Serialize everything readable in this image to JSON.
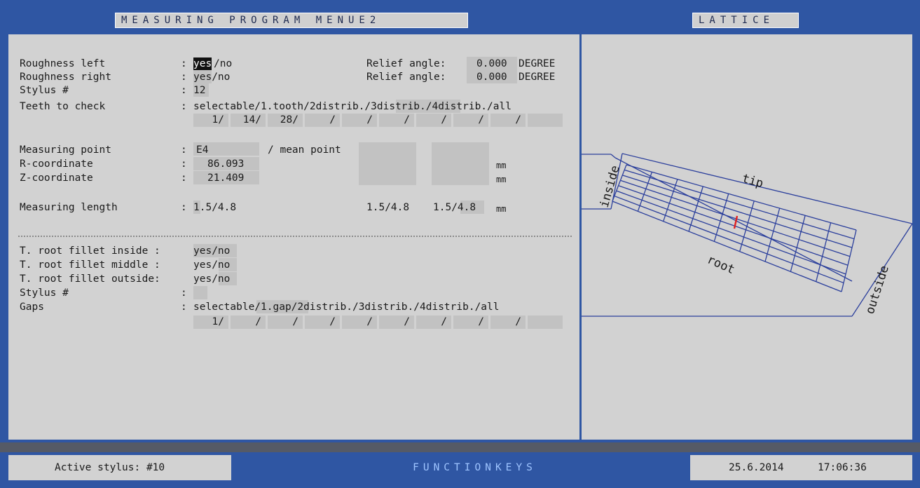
{
  "header": {
    "main_title": "MEASURING PROGRAM MENUE2",
    "right_title": "LATTICE"
  },
  "roughness": {
    "left_label": "Roughness left",
    "left_sep": ":",
    "left_yes": "yes",
    "left_no": "/no",
    "right_label": "Roughness right",
    "right_sep": ":",
    "right_value": "yes/no",
    "relief_label_1": "Relief angle:",
    "relief_value_1": "0.000",
    "relief_unit_1": "DEGREE",
    "relief_label_2": "Relief angle:",
    "relief_value_2": "0.000",
    "relief_unit_2": "DEGREE"
  },
  "stylus": {
    "label": "Stylus #",
    "sep": ":",
    "value": "12"
  },
  "teeth": {
    "label": "Teeth to check",
    "sep": ":",
    "options": "selectable/1.tooth/2distrib./3distrib./4distrib./all",
    "slots": [
      "1/",
      "14/",
      "28/",
      "/",
      "/",
      "/",
      "/",
      "/",
      "/",
      ""
    ]
  },
  "measuring_point": {
    "label": "Measuring point",
    "sep": ":",
    "value": "E4",
    "mean_label": "/ mean point"
  },
  "r_coordinate": {
    "label": "R-coordinate",
    "sep": ":",
    "value": "86.093",
    "unit": "mm"
  },
  "z_coordinate": {
    "label": "Z-coordinate",
    "sep": ":",
    "value": "21.409",
    "unit": "mm"
  },
  "measuring_length": {
    "label": "Measuring length",
    "sep": ":",
    "value": "1.5/4.8",
    "value_2": "1.5/4.8",
    "value_3": "1.5/4.8",
    "unit": "mm"
  },
  "fillet": {
    "inside_label": "T. root fillet inside :",
    "inside_value": "yes/no",
    "middle_label": "T. root fillet middle :",
    "middle_value": "yes/no",
    "outside_label": "T. root fillet outside:",
    "outside_value": "yes/no",
    "stylus_label": "Stylus #",
    "stylus_sep": ":"
  },
  "gaps": {
    "label": "Gaps",
    "sep": ":",
    "options": "selectable/1.gap/2distrib./3distrib./4distrib./all",
    "slots": [
      "1/",
      "/",
      "/",
      "/",
      "/",
      "/",
      "/",
      "/",
      "/",
      ""
    ]
  },
  "lattice": {
    "label_inside": "inside",
    "label_tip": "tip",
    "label_root": "root",
    "label_outside": "outside",
    "line_color": "#2b3f9c",
    "marker_color": "#e02020"
  },
  "status": {
    "active_stylus": "Active stylus: #10",
    "function_keys": "FUNCTIONKEYS",
    "date": "25.6.2014",
    "time": "17:06:36"
  }
}
